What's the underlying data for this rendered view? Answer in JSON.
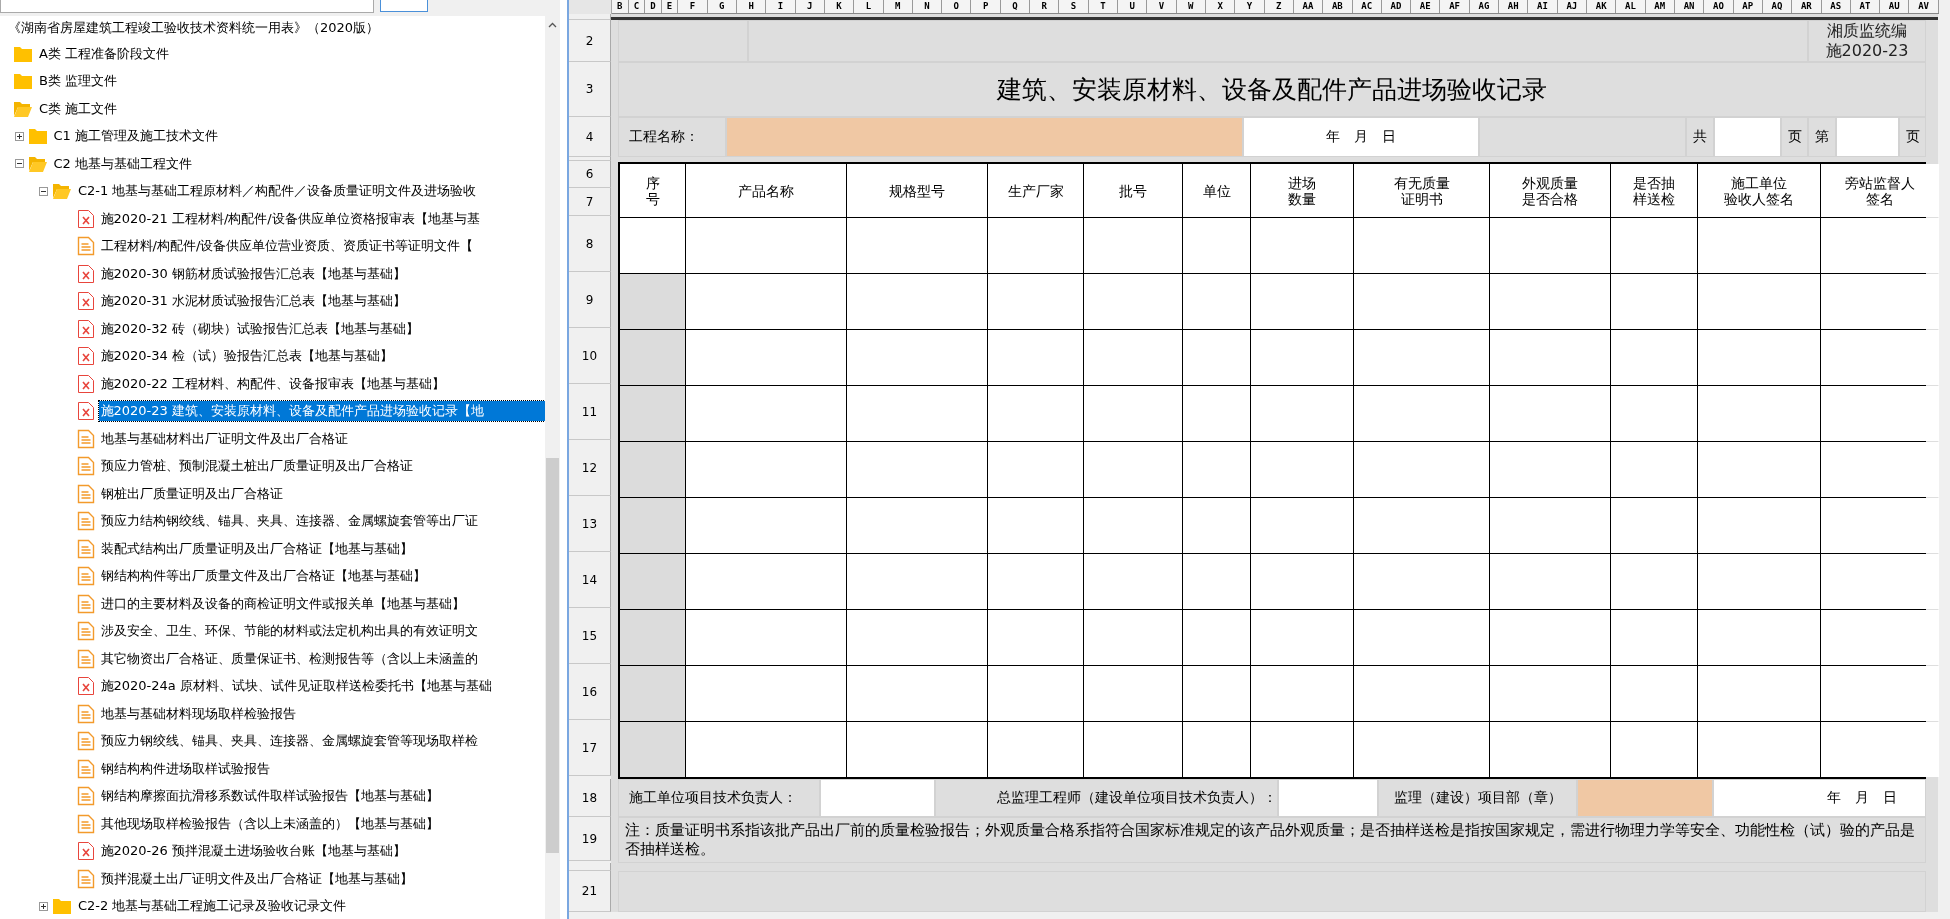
{
  "tree": {
    "title": "《湖南省房屋建筑工程竣工验收技术资料统一用表》（2020版）",
    "items": [
      {
        "kind": "folder",
        "label": "A类  工程准备阶段文件",
        "expanded": false,
        "selected": false
      },
      {
        "kind": "folder",
        "label": "B类  监理文件",
        "expanded": false,
        "selected": false
      },
      {
        "kind": "folder",
        "label": "C类  施工文件",
        "expanded": true,
        "selected": false,
        "children": [
          {
            "kind": "folder",
            "label": "C1  施工管理及施工技术文件",
            "expanded": false,
            "selected": false
          },
          {
            "kind": "folder",
            "label": "C2  地基与基础工程文件",
            "expanded": true,
            "selected": false,
            "children": [
              {
                "kind": "folder",
                "label": "C2-1  地基与基础工程原材料／构配件／设备质量证明文件及进场验收",
                "expanded": true,
                "selected": false,
                "children": [
                  {
                    "kind": "excel",
                    "label": "施2020-21  工程材料/构配件/设备供应单位资格报审表【地基与基",
                    "selected": false
                  },
                  {
                    "kind": "doc",
                    "label": "工程材料/构配件/设备供应单位营业资质、资质证书等证明文件【",
                    "selected": false
                  },
                  {
                    "kind": "excel",
                    "label": "施2020-30  钢筋材质试验报告汇总表【地基与基础】",
                    "selected": false
                  },
                  {
                    "kind": "excel",
                    "label": "施2020-31  水泥材质试验报告汇总表【地基与基础】",
                    "selected": false
                  },
                  {
                    "kind": "excel",
                    "label": "施2020-32  砖（砌块）试验报告汇总表【地基与基础】",
                    "selected": false
                  },
                  {
                    "kind": "excel",
                    "label": "施2020-34  检（试）验报告汇总表【地基与基础】",
                    "selected": false
                  },
                  {
                    "kind": "excel",
                    "label": "施2020-22  工程材料、构配件、设备报审表【地基与基础】",
                    "selected": false
                  },
                  {
                    "kind": "excel",
                    "label": "施2020-23  建筑、安装原材料、设备及配件产品进场验收记录【地",
                    "selected": true
                  },
                  {
                    "kind": "doc",
                    "label": "地基与基础材料出厂证明文件及出厂合格证",
                    "selected": false
                  },
                  {
                    "kind": "doc",
                    "label": "预应力管桩、预制混凝土桩出厂质量证明及出厂合格证",
                    "selected": false
                  },
                  {
                    "kind": "doc",
                    "label": "钢桩出厂质量证明及出厂合格证",
                    "selected": false
                  },
                  {
                    "kind": "doc",
                    "label": "预应力结构钢绞线、锚具、夹具、连接器、金属螺旋套管等出厂证",
                    "selected": false
                  },
                  {
                    "kind": "doc",
                    "label": "装配式结构出厂质量证明及出厂合格证【地基与基础】",
                    "selected": false
                  },
                  {
                    "kind": "doc",
                    "label": "钢结构构件等出厂质量文件及出厂合格证【地基与基础】",
                    "selected": false
                  },
                  {
                    "kind": "doc",
                    "label": "进口的主要材料及设备的商检证明文件或报关单【地基与基础】",
                    "selected": false
                  },
                  {
                    "kind": "doc",
                    "label": "涉及安全、卫生、环保、节能的材料或法定机构出具的有效证明文",
                    "selected": false
                  },
                  {
                    "kind": "doc",
                    "label": "其它物资出厂合格证、质量保证书、检测报告等（含以上未涵盖的",
                    "selected": false
                  },
                  {
                    "kind": "excel",
                    "label": "施2020-24a  原材料、试块、试件见证取样送检委托书【地基与基础",
                    "selected": false
                  },
                  {
                    "kind": "doc",
                    "label": "地基与基础材料现场取样检验报告",
                    "selected": false
                  },
                  {
                    "kind": "doc",
                    "label": "预应力钢绞线、锚具、夹具、连接器、金属螺旋套管等现场取样检",
                    "selected": false
                  },
                  {
                    "kind": "doc",
                    "label": "钢结构构件进场取样试验报告",
                    "selected": false
                  },
                  {
                    "kind": "doc",
                    "label": "钢结构摩擦面抗滑移系数试件取样试验报告【地基与基础】",
                    "selected": false
                  },
                  {
                    "kind": "doc",
                    "label": "其他现场取样检验报告（含以上未涵盖的）【地基与基础】",
                    "selected": false
                  },
                  {
                    "kind": "excel",
                    "label": "施2020-26  预拌混凝土进场验收台账【地基与基础】",
                    "selected": false
                  },
                  {
                    "kind": "doc",
                    "label": "预拌混凝土出厂证明文件及出厂合格证【地基与基础】",
                    "selected": false
                  }
                ]
              },
              {
                "kind": "folder",
                "label": "C2-2  地基与基础工程施工记录及验收记录文件",
                "expanded": false,
                "selected": false
              }
            ]
          }
        ]
      }
    ]
  },
  "sheet": {
    "column_letters": [
      "B",
      "C",
      "D",
      "E",
      "F",
      "G",
      "H",
      "I",
      "J",
      "K",
      "L",
      "M",
      "N",
      "O",
      "P",
      "Q",
      "R",
      "S",
      "T",
      "U",
      "V",
      "W",
      "X",
      "Y",
      "Z",
      "AA",
      "AB",
      "AC",
      "AD",
      "AE",
      "AF",
      "AG",
      "AH",
      "AI",
      "AJ",
      "AK",
      "AL",
      "AM",
      "AN",
      "AO",
      "AP",
      "AQ",
      "AR",
      "AS",
      "AT",
      "AU",
      "AV"
    ],
    "code_row": {
      "row": "2",
      "publisher": "湘质监统编",
      "form_number": "施2020-23"
    },
    "title_row": {
      "row": "3",
      "title": "建筑、安装原材料、设备及配件产品进场验收记录"
    },
    "info_row": {
      "row": "4",
      "project_label": "工程名称：",
      "date": "年　月　日",
      "total_label": "共",
      "total_unit": "页",
      "page_label": "第",
      "page_unit": "页"
    },
    "table": {
      "header_rows": [
        "6",
        "7"
      ],
      "columns": [
        [
          "序",
          "号"
        ],
        [
          "产品名称"
        ],
        [
          "规格型号"
        ],
        [
          "生产厂家"
        ],
        [
          "批号"
        ],
        [
          "单位"
        ],
        [
          "进场",
          "数量"
        ],
        [
          "有无质量",
          "证明书"
        ],
        [
          "外观质量",
          "是否合格"
        ],
        [
          "是否抽",
          "样送检"
        ],
        [
          "施工单位",
          "验收人签名"
        ],
        [
          "旁站监督人",
          "签名"
        ]
      ],
      "rows": [
        {
          "row": "8",
          "shaded": false
        },
        {
          "row": "9",
          "shaded": true
        },
        {
          "row": "10",
          "shaded": true
        },
        {
          "row": "11",
          "shaded": true
        },
        {
          "row": "12",
          "shaded": true
        },
        {
          "row": "13",
          "shaded": true
        },
        {
          "row": "14",
          "shaded": true
        },
        {
          "row": "15",
          "shaded": true
        },
        {
          "row": "16",
          "shaded": true
        },
        {
          "row": "17",
          "shaded": true
        }
      ]
    },
    "sign_row": {
      "row": "18",
      "builder_label": "施工单位项目技术负责人：",
      "chief_label": "总监理工程师（建设单位项目技术负责人）：",
      "stamp_label": "监理（建设）项目部（章）",
      "date": "年　月　日"
    },
    "note_row": {
      "row": "19",
      "note": "注：质量证明书系指该批产品出厂前的质量检验报告；外观质量合格系指符合国家标准规定的该产品外观质量；是否抽样送检是指按国家规定，需进行物理力学等安全、功能性检（试）验的产品是否抽样送检。"
    },
    "blank_row": {
      "row": "21"
    }
  }
}
